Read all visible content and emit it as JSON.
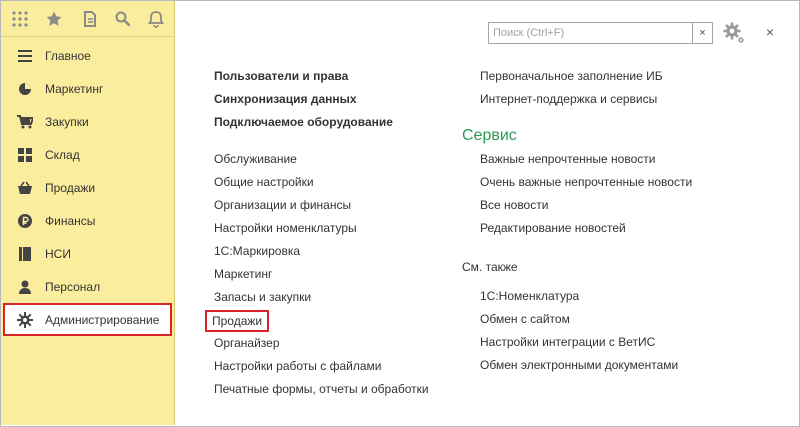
{
  "sidebar": {
    "top_icons": [
      "apps-grid-icon",
      "star-icon",
      "history-icon",
      "search-icon",
      "bell-icon"
    ],
    "items": [
      {
        "label": "Главное",
        "icon": "menu-lines-icon"
      },
      {
        "label": "Маркетинг",
        "icon": "pie-chart-icon"
      },
      {
        "label": "Закупки",
        "icon": "cart-icon"
      },
      {
        "label": "Склад",
        "icon": "warehouse-grid-icon"
      },
      {
        "label": "Продажи",
        "icon": "basket-icon"
      },
      {
        "label": "Финансы",
        "icon": "ruble-coin-icon"
      },
      {
        "label": "НСИ",
        "icon": "book-icon"
      },
      {
        "label": "Персонал",
        "icon": "person-icon"
      },
      {
        "label": "Администрирование",
        "icon": "gear-icon",
        "active": true
      }
    ]
  },
  "toolbar": {
    "search_placeholder": "Поиск (Ctrl+F)",
    "search_value": "",
    "clear_label": "×",
    "close_label": "×"
  },
  "main": {
    "col1_bold": [
      "Пользователи и права",
      "Синхронизация данных",
      "Подключаемое оборудование"
    ],
    "col1_links": [
      "Обслуживание",
      "Общие настройки",
      "Организации и финансы",
      "Настройки номенклатуры",
      "1С:Маркировка",
      "Маркетинг",
      "Запасы и закупки",
      "Продажи",
      "Органайзер",
      "Настройки работы с файлами",
      "Печатные формы, отчеты и обработки"
    ],
    "col2_top": [
      "Первоначальное заполнение ИБ",
      "Интернет-поддержка и сервисы"
    ],
    "section_service": "Сервис",
    "service_links": [
      "Важные непрочтенные новости",
      "Очень важные непрочтенные новости",
      "Все новости",
      "Редактирование новостей"
    ],
    "section_see_also": "См. также",
    "see_also_links": [
      "1С:Номенклатура",
      "Обмен с сайтом",
      "Настройки интеграции с ВетИС",
      "Обмен электронными документами"
    ]
  },
  "colors": {
    "sidebar_bg": "#fbed9e",
    "highlight": "#d8232a",
    "section_green": "#2a9b54"
  }
}
